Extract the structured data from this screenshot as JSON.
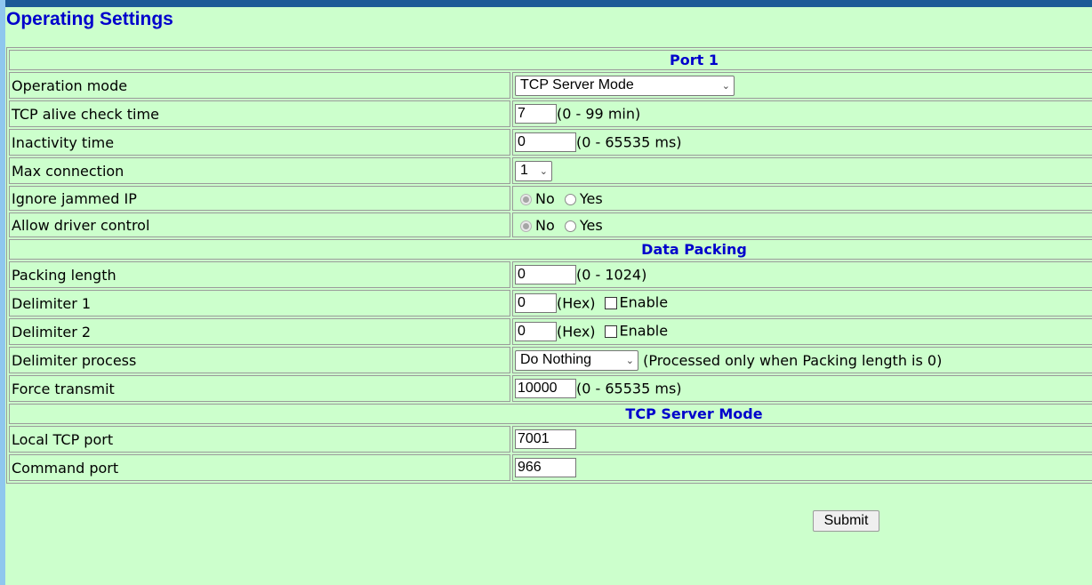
{
  "page": {
    "title": "Operating Settings"
  },
  "sections": {
    "port": "Port 1",
    "data_packing": "Data Packing",
    "tcp_server": "TCP Server Mode"
  },
  "fields": {
    "operation_mode": {
      "label": "Operation mode",
      "value": "TCP Server Mode"
    },
    "tcp_alive": {
      "label": "TCP alive check time",
      "value": "7",
      "hint": "(0 - 99 min)"
    },
    "inactivity": {
      "label": "Inactivity time",
      "value": "0",
      "hint": "(0 - 65535 ms)"
    },
    "max_connection": {
      "label": "Max connection",
      "value": "1"
    },
    "ignore_jammed": {
      "label": "Ignore jammed IP",
      "no": "No",
      "yes": "Yes",
      "selected": "No"
    },
    "allow_driver": {
      "label": "Allow driver control",
      "no": "No",
      "yes": "Yes",
      "selected": "No"
    },
    "packing_length": {
      "label": "Packing length",
      "value": "0",
      "hint": "(0 - 1024)"
    },
    "delimiter1": {
      "label": "Delimiter 1",
      "value": "0",
      "hint": "(Hex)",
      "enable": "Enable"
    },
    "delimiter2": {
      "label": "Delimiter 2",
      "value": "0",
      "hint": "(Hex)",
      "enable": "Enable"
    },
    "delimiter_process": {
      "label": "Delimiter process",
      "value": "Do Nothing",
      "hint": "(Processed only when Packing length is 0)"
    },
    "force_transmit": {
      "label": "Force transmit",
      "value": "10000",
      "hint": "(0 - 65535 ms)"
    },
    "local_tcp_port": {
      "label": "Local TCP port",
      "value": "7001"
    },
    "command_port": {
      "label": "Command port",
      "value": "966"
    }
  },
  "actions": {
    "submit": "Submit"
  }
}
